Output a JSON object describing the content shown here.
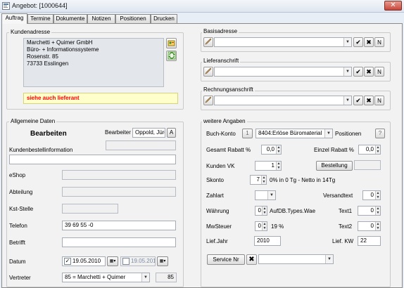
{
  "window": {
    "title": "Angebot: [1000644]",
    "close_glyph": "✕"
  },
  "tabs": [
    {
      "label": "Auftrag",
      "active": true
    },
    {
      "label": "Termine"
    },
    {
      "label": "Dokumente"
    },
    {
      "label": "Notizen"
    },
    {
      "label": "Positionen"
    },
    {
      "label": "Drucken"
    }
  ],
  "kundenadresse": {
    "legend": "Kundenadresse",
    "lines": [
      "Marchetti + Quimer GmbH",
      "Büro- + Informationssysteme",
      "Rosenstr. 85",
      "73733 Esslingen"
    ],
    "warning": "siehe auch lieferant",
    "warning_color": "#ff0000",
    "warning_bg": "#ffffcc"
  },
  "basisadresse": {
    "legend": "Basisadresse"
  },
  "lieferanschrift": {
    "legend": "Lieferanschrift"
  },
  "rechnungsanschrift": {
    "legend": "Rechnungsanschrift"
  },
  "address_buttons": {
    "ok": "✔",
    "cancel": "✖",
    "n": "N"
  },
  "allgemeine": {
    "legend": "Allgemeine Daten",
    "mode": "Bearbeiten",
    "bearbeiter_label": "Bearbeiter",
    "bearbeiter_value": "Oppold, Jürg",
    "bearbeiter_btn": "A",
    "kundenbestell_label": "Kundenbestellinformation",
    "eshop_label": "eShop",
    "abteilung_label": "Abteilung",
    "kst_label": "Kst-Stelle",
    "telefon_label": "Telefon",
    "telefon_value": "39 69 55 -0",
    "betrifft_label": "Betrifft",
    "datum_label": "Datum",
    "datum_value1": "19.05.2010",
    "datum_value2": "19.05.2010",
    "vertreter_label": "Vertreter",
    "vertreter_value": "85 = Marchetti + Quimer",
    "vertreter_num": "85"
  },
  "weitere": {
    "legend": "weitere Angaben",
    "buchkonto_label": "Buch-Konto",
    "buchkonto_num": "1",
    "buchkonto_value": "8404:Erlöse Büromaterial",
    "positionen_label": "Positionen",
    "positionen_btn": "?",
    "gesamt_label": "Gesamt Rabatt %",
    "gesamt_value": "0,0",
    "einzel_label": "Einzel Rabatt %",
    "einzel_value": "0,0",
    "kundenvk_label": "Kunden VK",
    "kundenvk_value": "1",
    "bestellung_btn": "Bestellung",
    "skonto_label": "Skonto",
    "skonto_value": "7",
    "skonto_text": "0% in 0 Tg - Netto in 14Tg",
    "zahlart_label": "Zahlart",
    "versandtext_label": "Versandtext",
    "versandtext_value": "0",
    "waehrung_label": "Währung",
    "waehrung_value": "0",
    "waehrung_text": "AufDB.Types.Wae",
    "text1_label": "Text1",
    "text1_value": "0",
    "mwst_label": "MwSteuer",
    "mwst_value": "0",
    "mwst_text": "19 %",
    "text2_label": "Text2",
    "text2_value": "0",
    "liefjahr_label": "Lief.Jahr",
    "liefjahr_value": "2010",
    "liefkw_label": "Lief. KW",
    "liefkw_value": "22",
    "service_btn": "Service Nr",
    "service_x": "✖"
  }
}
